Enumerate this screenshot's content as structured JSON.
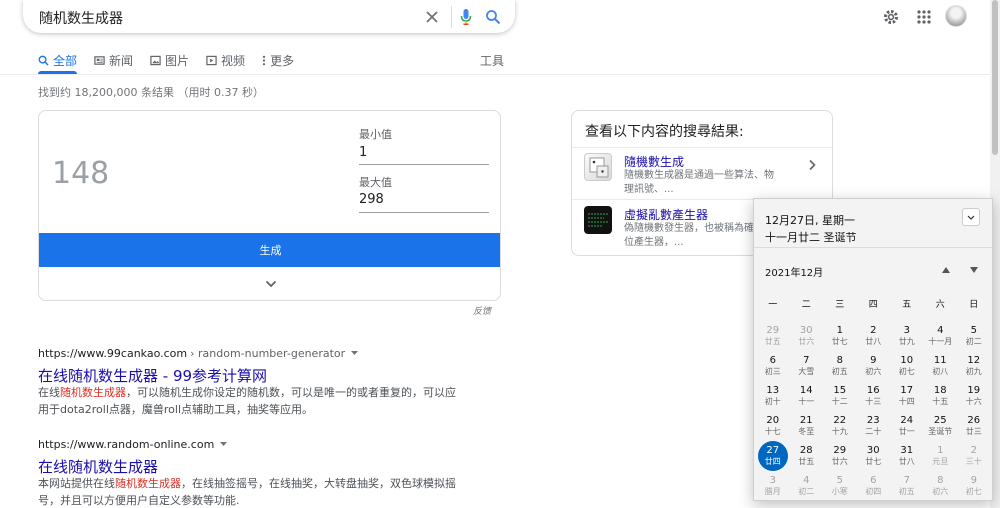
{
  "search": {
    "query": "随机数生成器"
  },
  "tabs": [
    {
      "label": "全部",
      "active": true,
      "icon": "search-icon"
    },
    {
      "label": "新闻",
      "active": false,
      "icon": "news-icon"
    },
    {
      "label": "图片",
      "active": false,
      "icon": "image-icon"
    },
    {
      "label": "视频",
      "active": false,
      "icon": "video-icon"
    },
    {
      "label": "更多",
      "active": false,
      "icon": "more-vert-icon"
    }
  ],
  "tools_label": "工具",
  "result_stats": "找到约 18,200,000 条结果 （用时 0.37 秒）",
  "rng": {
    "value": "148",
    "min_label": "最小值",
    "min_value": "1",
    "max_label": "最大值",
    "max_value": "298",
    "generate_label": "生成",
    "feedback": "反馈"
  },
  "results": [
    {
      "url": "https://www.99cankao.com",
      "path": "› random-number-generator",
      "title": "在线随机数生成器 - 99参考计算网",
      "snippet_pre": "在线",
      "snippet_hl": "随机数生成器",
      "snippet_post": "，可以随机生成你设定的随机数，可以是唯一的或者重复的，可以应用于dota2roll点器，魔兽roll点辅助工具，抽奖等应用。"
    },
    {
      "url": "https://www.random-online.com",
      "path": "",
      "title": "在线随机数生成器",
      "snippet_pre": "本网站提供在线",
      "snippet_hl": "随机数生成器",
      "snippet_post": "，在线抽签摇号，在线抽奖，大转盘抽奖，双色球模拟摇号，并且可以方便用户自定义参数等功能."
    }
  ],
  "kp": {
    "title": "查看以下内容的搜尋結果:",
    "items": [
      {
        "title": "隨機數生成",
        "desc": "隨機數生成器是通過一些算法、物理訊號、..."
      },
      {
        "title": "虛擬亂數產生器",
        "desc": "偽隨機數發生器，也被稱為確定性位產生器，..."
      }
    ]
  },
  "calendar": {
    "date_label": "12月27日, 星期一",
    "lunar_label": "十一月廿二 圣诞节",
    "month_label": "2021年12月",
    "weekdays": [
      "一",
      "二",
      "三",
      "四",
      "五",
      "六",
      "日"
    ],
    "days": [
      {
        "d": "29",
        "l": "廿五",
        "other": true
      },
      {
        "d": "30",
        "l": "廿六",
        "other": true
      },
      {
        "d": "1",
        "l": "廿七"
      },
      {
        "d": "2",
        "l": "廿八"
      },
      {
        "d": "3",
        "l": "廿九"
      },
      {
        "d": "4",
        "l": "十一月"
      },
      {
        "d": "5",
        "l": "初二"
      },
      {
        "d": "6",
        "l": "初三"
      },
      {
        "d": "7",
        "l": "大雪"
      },
      {
        "d": "8",
        "l": "初五"
      },
      {
        "d": "9",
        "l": "初六"
      },
      {
        "d": "10",
        "l": "初七"
      },
      {
        "d": "11",
        "l": "初八"
      },
      {
        "d": "12",
        "l": "初九"
      },
      {
        "d": "13",
        "l": "初十"
      },
      {
        "d": "14",
        "l": "十一"
      },
      {
        "d": "15",
        "l": "十二"
      },
      {
        "d": "16",
        "l": "十三"
      },
      {
        "d": "17",
        "l": "十四"
      },
      {
        "d": "18",
        "l": "十五"
      },
      {
        "d": "19",
        "l": "十六"
      },
      {
        "d": "20",
        "l": "十七"
      },
      {
        "d": "21",
        "l": "冬至"
      },
      {
        "d": "22",
        "l": "十九"
      },
      {
        "d": "23",
        "l": "二十"
      },
      {
        "d": "24",
        "l": "廿一"
      },
      {
        "d": "25",
        "l": "圣诞节"
      },
      {
        "d": "26",
        "l": "廿三"
      },
      {
        "d": "27",
        "l": "廿四",
        "today": true
      },
      {
        "d": "28",
        "l": "廿五"
      },
      {
        "d": "29",
        "l": "廿六"
      },
      {
        "d": "30",
        "l": "廿七"
      },
      {
        "d": "31",
        "l": "廿八"
      },
      {
        "d": "1",
        "l": "元旦",
        "other": true
      },
      {
        "d": "2",
        "l": "三十",
        "other": true
      },
      {
        "d": "3",
        "l": "腊月",
        "other": true
      },
      {
        "d": "4",
        "l": "初二",
        "other": true
      },
      {
        "d": "5",
        "l": "小寒",
        "other": true
      },
      {
        "d": "6",
        "l": "初四",
        "other": true
      },
      {
        "d": "7",
        "l": "初五",
        "other": true
      },
      {
        "d": "8",
        "l": "初六",
        "other": true
      },
      {
        "d": "9",
        "l": "初七",
        "other": true
      }
    ]
  },
  "colors": {
    "accent": "#1a73e8",
    "link": "#1a0dab",
    "highlight": "#d93025",
    "today": "#0067c0"
  }
}
